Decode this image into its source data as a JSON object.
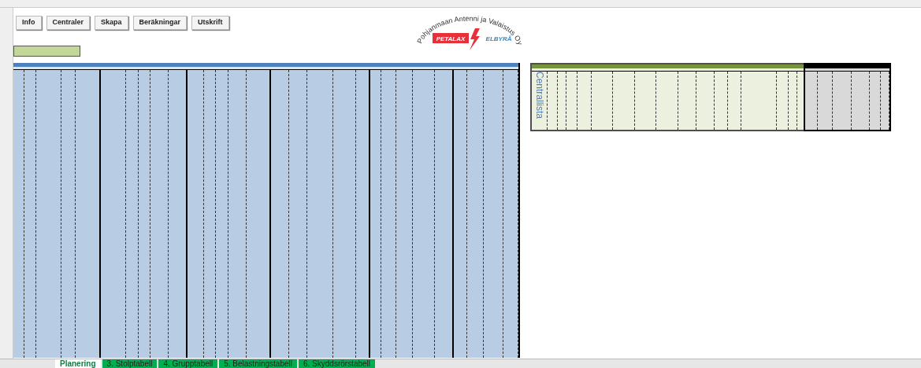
{
  "toolbar_buttons": [
    "Info",
    "Centraler",
    "Skapa",
    "Beräkningar",
    "Utskrift"
  ],
  "logo": {
    "company": "Pohjanmaan Antenni ja Valaistus Oy",
    "brand_left": "PETALAX",
    "brand_right": "ELBYRÅ"
  },
  "centrallista": {
    "title": "Centrallista"
  },
  "sheet_tabs": [
    {
      "label": "Planering",
      "selected": true
    },
    {
      "label": "3. Stolptabell",
      "selected": false
    },
    {
      "label": "4. Grupptabell",
      "selected": false
    },
    {
      "label": "5. Belastningstabell",
      "selected": false
    },
    {
      "label": "6. Skyddsrörstabell",
      "selected": false
    }
  ]
}
